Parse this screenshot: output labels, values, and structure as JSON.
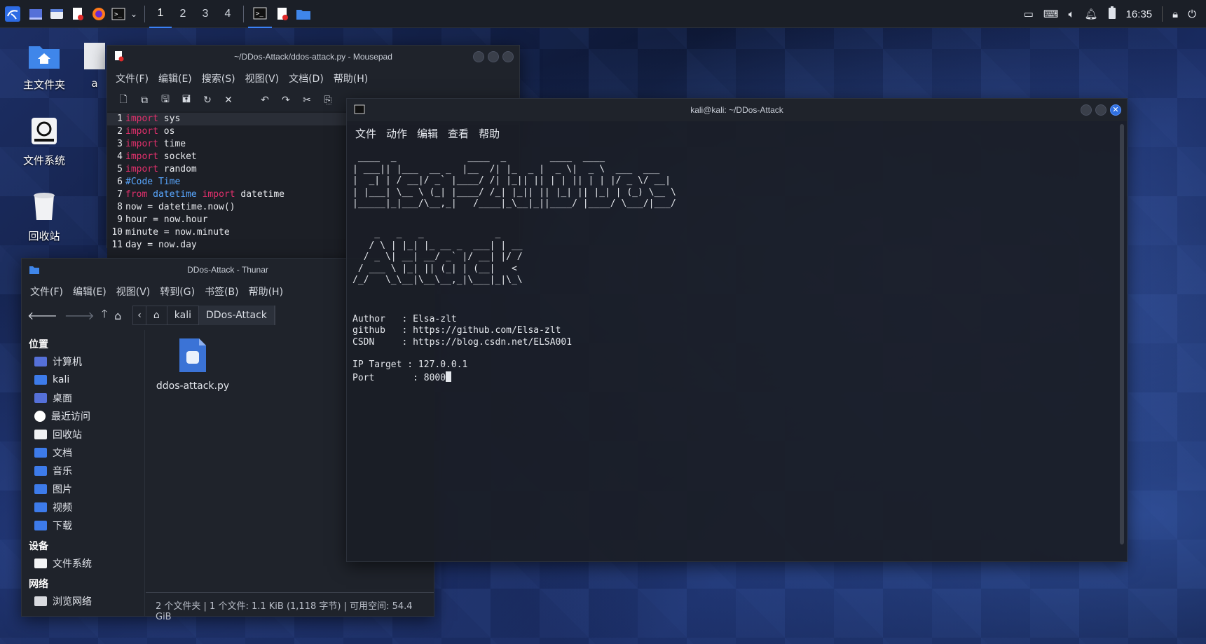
{
  "panel": {
    "workspaces": [
      "1",
      "2",
      "3",
      "4"
    ],
    "clock": "16:35"
  },
  "desktop": {
    "icons": [
      {
        "label": "主文件夹"
      },
      {
        "label": "文件系统"
      },
      {
        "label": "回收站"
      }
    ],
    "partial_label": "a"
  },
  "mousepad": {
    "title": "~/DDos-Attack/ddos-attack.py - Mousepad",
    "menu": [
      "文件(F)",
      "编辑(E)",
      "搜索(S)",
      "视图(V)",
      "文档(D)",
      "帮助(H)"
    ],
    "lines": [
      {
        "n": "1",
        "kw": "import",
        "rest": " sys"
      },
      {
        "n": "2",
        "kw": "import",
        "rest": " os"
      },
      {
        "n": "3",
        "kw": "import",
        "rest": " time"
      },
      {
        "n": "4",
        "kw": "import",
        "rest": " socket"
      },
      {
        "n": "5",
        "kw": "import",
        "rest": " random"
      },
      {
        "n": "6",
        "comment": "#Code Time"
      },
      {
        "n": "7",
        "kw": "from",
        "mod": " datetime",
        "kw2": " import",
        "rest": " datetime"
      },
      {
        "n": "8",
        "rest": "now = datetime.now()"
      },
      {
        "n": "9",
        "rest": "hour = now.hour"
      },
      {
        "n": "10",
        "rest": "minute = now.minute"
      },
      {
        "n": "11",
        "rest": "day = now.day"
      }
    ]
  },
  "thunar": {
    "title": "DDos-Attack - Thunar",
    "menu": [
      "文件(F)",
      "编辑(E)",
      "视图(V)",
      "转到(G)",
      "书签(B)",
      "帮助(H)"
    ],
    "breadcrumb": [
      "kali",
      "DDos-Attack"
    ],
    "sections": [
      {
        "heading": "位置",
        "items": [
          "计算机",
          "kali",
          "桌面",
          "最近访问",
          "回收站",
          "文档",
          "音乐",
          "图片",
          "视频",
          "下载"
        ]
      },
      {
        "heading": "设备",
        "items": [
          "文件系统"
        ]
      },
      {
        "heading": "网络",
        "items": [
          "浏览网络"
        ]
      }
    ],
    "file": {
      "name": "ddos-attack.py"
    },
    "status": "2 个文件夹 | 1 个文件: 1.1 KiB (1,118 字节) | 可用空间: 54.4 GiB"
  },
  "terminal": {
    "title": "kali@kali: ~/DDos-Attack",
    "menu": [
      "文件",
      "动作",
      "编辑",
      "查看",
      "帮助"
    ],
    "banner1": " ____  _             ____  _        ____  ____\n| ___|| |___  __ _  |__  /| |_  _ |  _ \\|  _ \\  ___  ___\n|  _| | / __|/ _` |____/ /| |_|| || | | || | | |/ _ \\/ __|\n| |___| \\__ \\ (_| |____/ /_| |_|| || |_| || |_| | (_) \\__ \\\n|_____|_|___/\\__,_|   /____|_\\__|_||____/ |____/ \\___/|___/",
    "banner2": "    _   _   _             _\n   / \\ | |_| |_ __ _  ___| | __\n  / _ \\| __| __/ _` |/ __| |/ /\n / ___ \\ |_| || (_| | (__|   <\n/_/   \\_\\__|\\__\\__,_|\\___|_|\\_\\",
    "info": [
      "Author   : Elsa-zlt",
      "github   : https://github.com/Elsa-zlt",
      "CSDN     : https://blog.csdn.net/ELSA001",
      "",
      "IP Target : 127.0.0.1"
    ],
    "prompt_line": "Port       : 8000"
  }
}
